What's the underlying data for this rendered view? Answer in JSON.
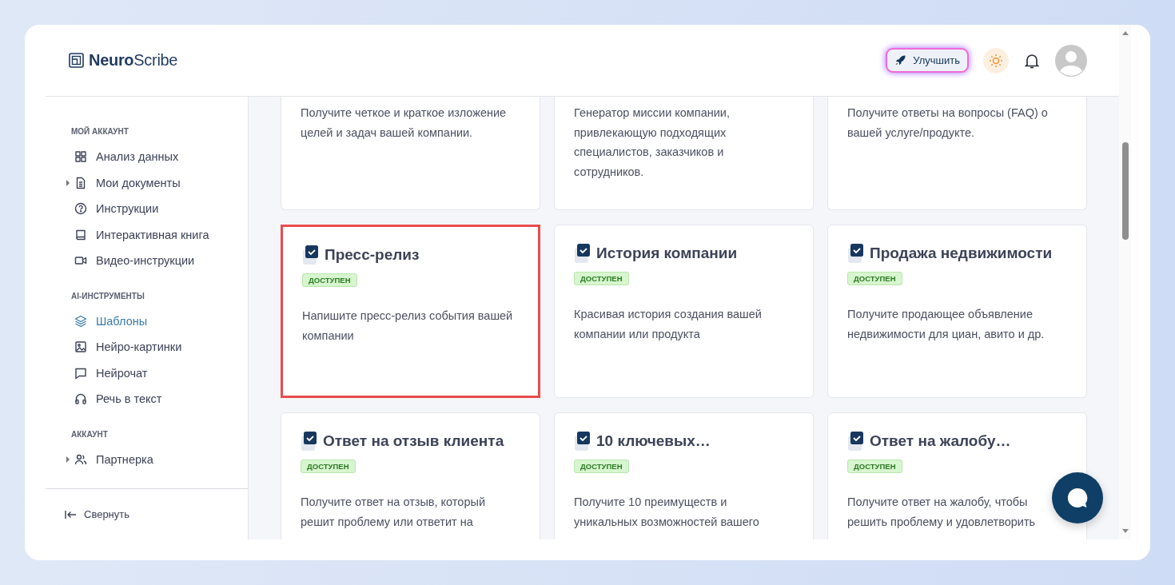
{
  "header": {
    "logo": {
      "bold": "Neuro",
      "light": "Scribe"
    },
    "upgrade_button": "Улучшить"
  },
  "sidebar": {
    "sections": [
      {
        "title": "МОЙ АККАУНТ",
        "items": [
          {
            "label": "Анализ данных",
            "kind": "link",
            "selected": false
          },
          {
            "label": "Мои документы",
            "kind": "group",
            "selected": false
          },
          {
            "label": "Инструкции",
            "kind": "link",
            "selected": false
          },
          {
            "label": "Интерактивная книга",
            "kind": "link",
            "selected": false
          },
          {
            "label": "Видео-инструкции",
            "kind": "link",
            "selected": false
          }
        ]
      },
      {
        "title": "AI-ИНСТРУМЕНТЫ",
        "items": [
          {
            "label": "Шаблоны",
            "kind": "link",
            "selected": true
          },
          {
            "label": "Нейро-картинки",
            "kind": "link",
            "selected": false
          },
          {
            "label": "Нейрочат",
            "kind": "link",
            "selected": false
          },
          {
            "label": "Речь в текст",
            "kind": "link",
            "selected": false
          }
        ]
      },
      {
        "title": "АККАУНТ",
        "items": [
          {
            "label": "Партнерка",
            "kind": "group",
            "selected": false
          }
        ]
      }
    ],
    "collapse": "Свернуть"
  },
  "cards": [
    {
      "kind": "partial",
      "description": "Получите четкое и краткое изложение целей и задач вашей компании.",
      "selected": false
    },
    {
      "kind": "partial",
      "description": "Генератор миссии компании, привлекающую подходящих специалистов, заказчиков и сотрудников.",
      "selected": false
    },
    {
      "kind": "partial",
      "description": "Получите ответы на вопросы (FAQ) о вашей услуге/продукте.",
      "selected": false
    },
    {
      "kind": "full",
      "title": "Пресс-релиз",
      "badge": "ДОСТУПЕН",
      "description": "Напишите пресс-релиз события вашей компании",
      "selected": true
    },
    {
      "kind": "full",
      "title": "История компании",
      "badge": "ДОСТУПЕН",
      "description": "Красивая история создания вашей компании или продукта",
      "selected": false
    },
    {
      "kind": "full",
      "title": "Продажа недвижимости",
      "badge": "ДОСТУПЕН",
      "description": "Получите продающее объявление недвижимости для циан, авито и др.",
      "selected": false
    },
    {
      "kind": "full",
      "title": "Ответ на отзыв клиента",
      "badge": "ДОСТУПЕН",
      "description": "Получите ответ на отзыв, который решит проблему или ответит на",
      "selected": false
    },
    {
      "kind": "full",
      "title": "10 ключевых…",
      "badge": "ДОСТУПЕН",
      "description": "Получите 10 преимуществ и уникальных возможностей вашего",
      "selected": false
    },
    {
      "kind": "full",
      "title": "Ответ на жалобу…",
      "badge": "ДОСТУПЕН",
      "description": "Получите ответ на жалобу, чтобы решить проблему и удовлетворить",
      "selected": false
    }
  ]
}
